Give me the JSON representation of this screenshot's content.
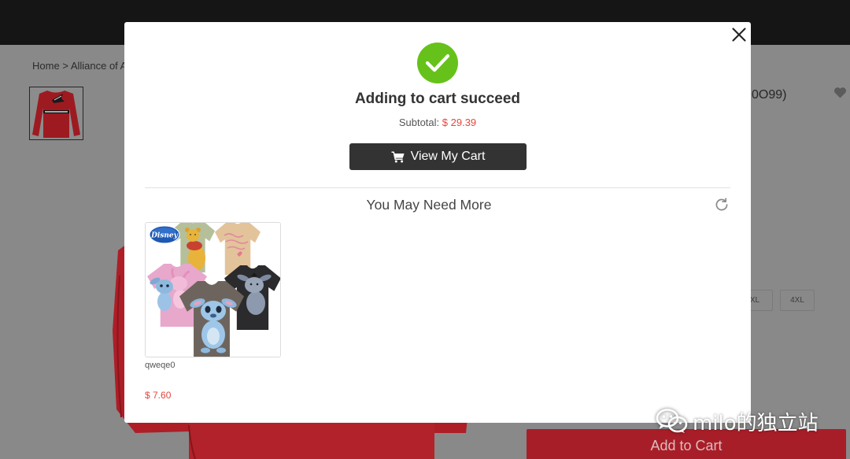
{
  "background_page": {
    "breadcrumb": {
      "home": "Home",
      "separator": ">",
      "current": "Alliance of A"
    },
    "product_title": "0O99)",
    "sizes": [
      "XL",
      "4XL"
    ],
    "add_to_cart_label": "Add to Cart"
  },
  "modal": {
    "title": "Adding to cart succeed",
    "subtotal": {
      "label": "Subtotal:",
      "value": "$ 29.39"
    },
    "view_cart_label": "View My Cart",
    "recommendations": {
      "title": "You May Need More",
      "items": [
        {
          "name": "qweqe0",
          "price": "$ 7.60",
          "logo_text": "Disney"
        }
      ]
    }
  },
  "icons": {
    "close": "close-icon",
    "success": "check-circle-icon",
    "cart": "cart-icon",
    "refresh": "refresh-icon",
    "wishlist": "heart-icon",
    "watermark_logo": "wechat-icon"
  },
  "colors": {
    "success_green": "#66c21a",
    "price_red": "#e8453c",
    "dark_button": "#333333",
    "add_to_cart_red": "#a81e28"
  },
  "watermark": {
    "text": "milo的独立站"
  }
}
